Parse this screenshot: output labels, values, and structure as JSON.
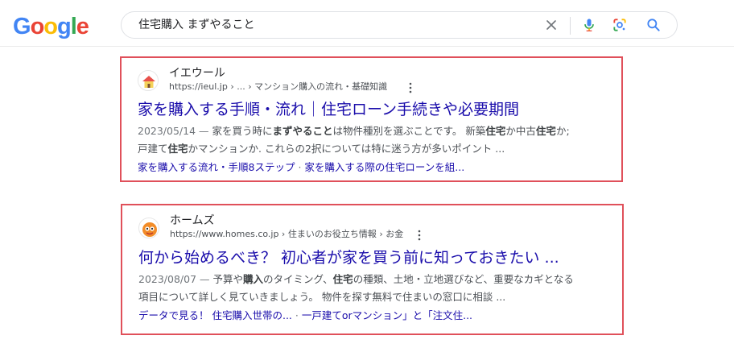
{
  "header": {
    "logo_letters": [
      "G",
      "o",
      "o",
      "g",
      "l",
      "e"
    ],
    "logo_colors": [
      "#4285f4",
      "#ea4335",
      "#fbbc05",
      "#4285f4",
      "#34a853",
      "#ea4335"
    ],
    "search_query": "住宅購入 まずやること",
    "icons": [
      "close-icon",
      "microphone-icon",
      "google-lens-icon",
      "search-icon"
    ]
  },
  "results": [
    {
      "site_name": "イエウール",
      "site_url": "https://ieul.jp › ... › マンション購入の流れ・基礎知識",
      "favicon": "house-icon",
      "title": "家を購入する手順・流れ｜住宅ローン手続きや必要期間",
      "date": "2023/05/14 — ",
      "snippet_line1_parts": [
        "家を買う時に",
        "まずやること",
        "は物件種別を選ぶことです。 新築",
        "住宅",
        "か中古",
        "住宅",
        "か;"
      ],
      "snippet_line2_parts": [
        "戸建て",
        "住宅",
        "かマンションか. これらの2択については特に迷う方が多いポイント ..."
      ],
      "sitelinks": [
        "家を購入する流れ・手順8ステップ",
        "家を購入する際の住宅ローンを組..."
      ],
      "sitelink_separator": " · "
    },
    {
      "site_name": "ホームズ",
      "site_url": "https://www.homes.co.jp › 住まいのお役立ち情報 › お金",
      "favicon": "homes-mascot-icon",
      "title": "何から始めるべき？ 初心者が家を買う前に知っておきたい ...",
      "date": "2023/08/07 — ",
      "snippet_line1_parts": [
        "予算や",
        "購入",
        "のタイミング、",
        "住宅",
        "の種類、土地・立地選びなど、重要なカギとなる"
      ],
      "snippet_line2_parts": [
        "項目について詳しく見ていきましょう。 物件を探す無料で住まいの窓口に相談 ..."
      ],
      "sitelinks": [
        "データで見る！ 住宅購入世帯の...",
        "一戸建てorマンション」と「注文住..."
      ],
      "sitelink_separator": " · "
    }
  ],
  "colors": {
    "link": "#1a0dab",
    "highlight_border": "#e0505a"
  }
}
